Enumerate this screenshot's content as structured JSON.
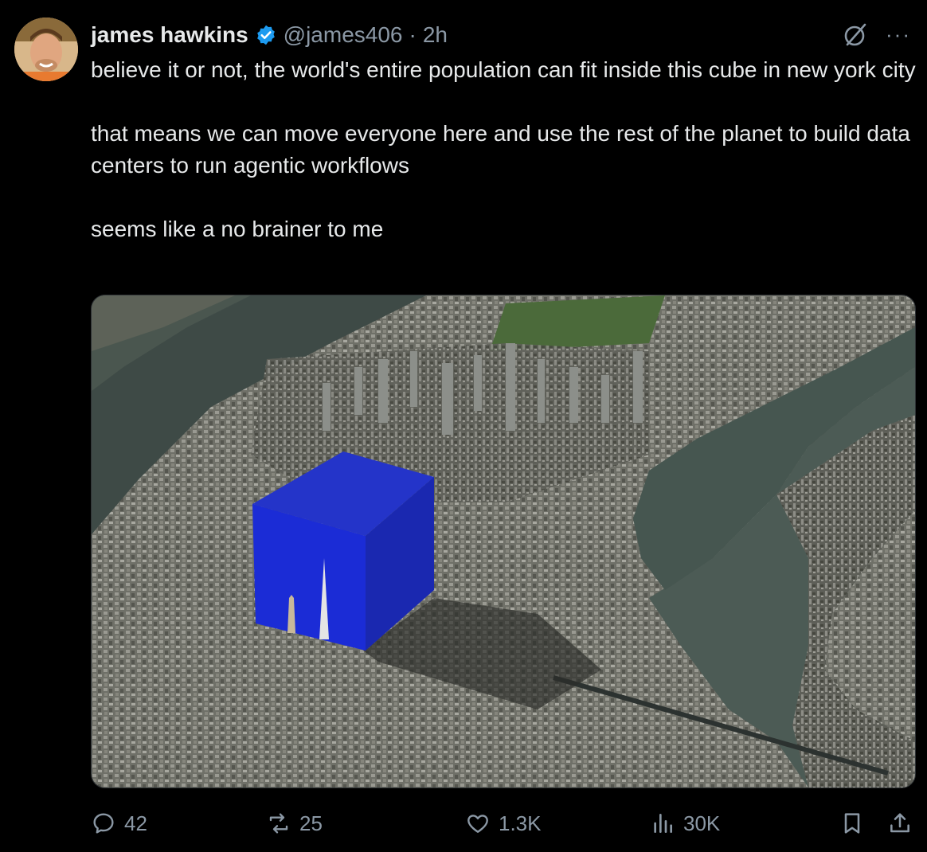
{
  "tweet": {
    "author_name": "james hawkins",
    "handle": "@james406",
    "separator": "·",
    "time": "2h",
    "paragraphs": [
      "believe it or not, the world's entire population can fit inside this cube in new york city",
      "that means we can move everyone here and use the rest of the planet to build data centers to run agentic workflows",
      "seems like a no brainer to me"
    ],
    "more_label": "···"
  },
  "stats": {
    "replies": "42",
    "reposts": "25",
    "likes": "1.3K",
    "views": "30K"
  },
  "colors": {
    "background": "#000000",
    "text": "#e7e9ea",
    "muted": "#8b98a5",
    "verified": "#1d9bf0",
    "cube_front": "#1a2fd0",
    "cube_top": "#2233c8"
  },
  "icons": {
    "verified": "verified-badge-icon",
    "grok": "grok-icon",
    "reply": "reply-icon",
    "repost": "repost-icon",
    "like": "heart-icon",
    "views": "views-chart-icon",
    "bookmark": "bookmark-icon",
    "share": "share-icon"
  }
}
